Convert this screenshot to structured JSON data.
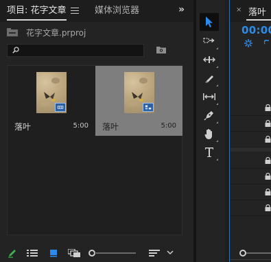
{
  "project_panel": {
    "active_tab": "项目: 花字文章",
    "inactive_tab": "媒体浏览器",
    "overflow": "»",
    "project_file": "花字文章.prproj",
    "search": {
      "value": "",
      "placeholder": ""
    },
    "clips": [
      {
        "name": "落叶",
        "duration": "5:00",
        "selected": false,
        "badge_icon": "video-film-icon"
      },
      {
        "name": "落叶",
        "duration": "5:00",
        "selected": true,
        "badge_icon": "sequence-icon"
      }
    ],
    "bottom_bar": [
      "pencil-icon",
      "list-view-icon",
      "icon-view-icon",
      "freeform-view-icon",
      "zoom-slider",
      "sort-icon",
      "chevron-down-icon"
    ]
  },
  "tools_panel": {
    "tools": [
      "selection-tool",
      "track-select-tool",
      "ripple-edit-tool",
      "razor-tool",
      "slip-tool",
      "pen-tool",
      "hand-tool",
      "type-tool"
    ],
    "active_tool": "selection-tool"
  },
  "timeline_panel": {
    "close_glyph": "×",
    "title": "落叶",
    "timecode": "00:00",
    "tracks_locked_count": 7
  },
  "colors": {
    "accent_blue": "#2d8ceb",
    "selection_gray": "#7e7e7e",
    "pencil_green": "#3fb24f",
    "badge_blue": "#2a5fa3"
  }
}
